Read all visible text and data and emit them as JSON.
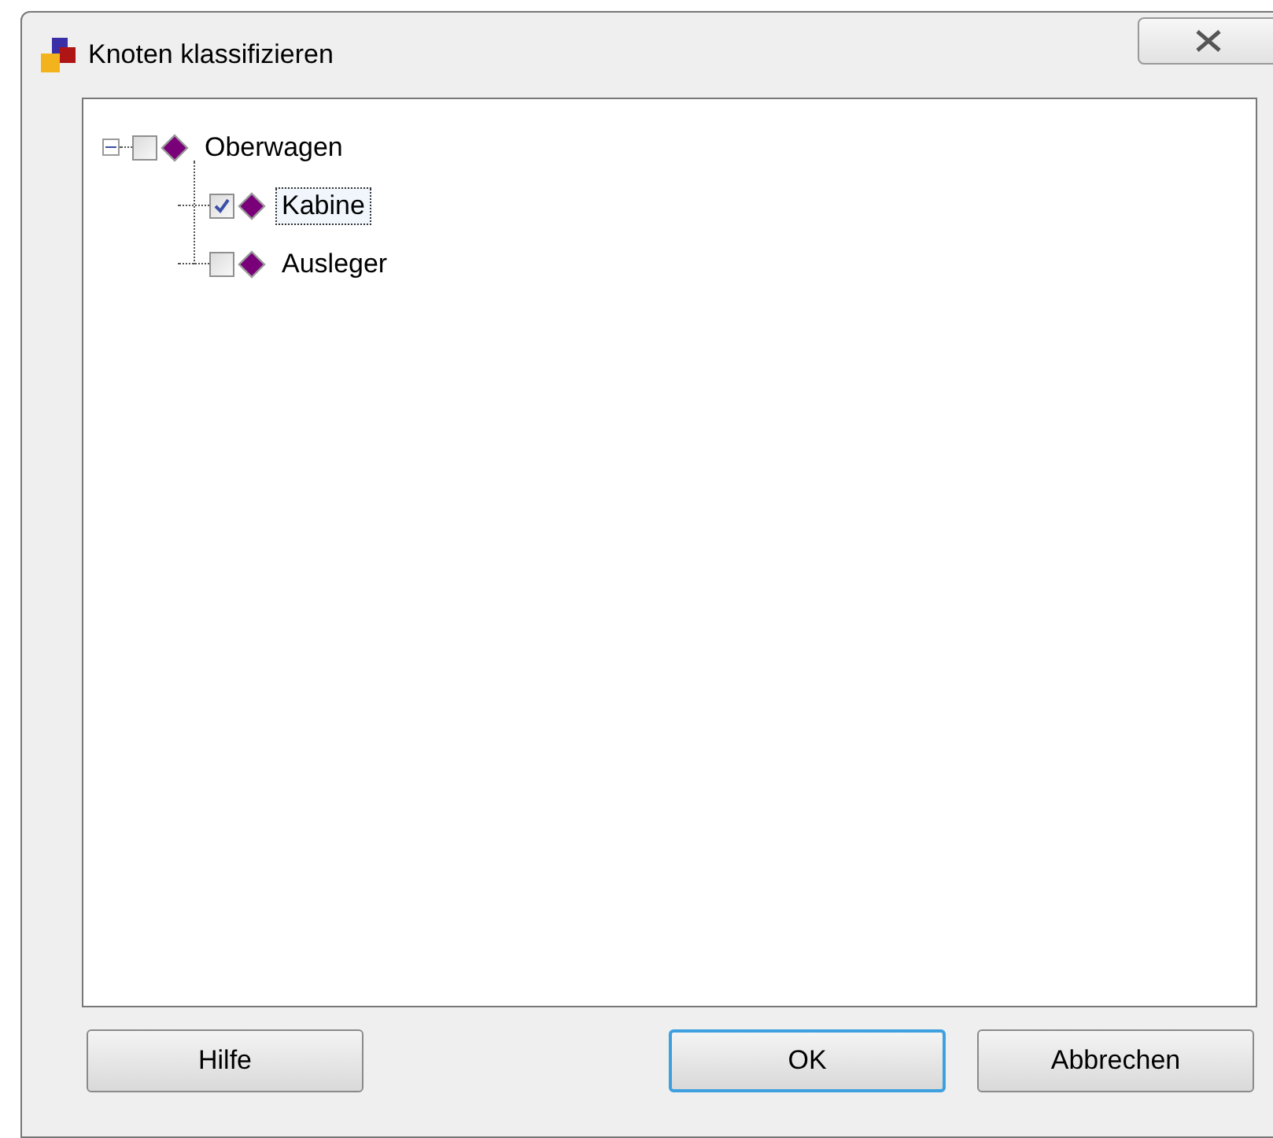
{
  "window": {
    "title": "Knoten klassifizieren"
  },
  "tree": [
    {
      "label": "Oberwagen",
      "expanded": true,
      "checked": false,
      "selected": false,
      "children": [
        {
          "label": "Kabine",
          "checked": true,
          "selected": true
        },
        {
          "label": "Ausleger",
          "checked": false,
          "selected": false
        }
      ]
    }
  ],
  "buttons": [
    {
      "label": "Hilfe",
      "default": false
    },
    {
      "label": "OK",
      "default": true
    },
    {
      "label": "Abbrechen",
      "default": false
    }
  ]
}
